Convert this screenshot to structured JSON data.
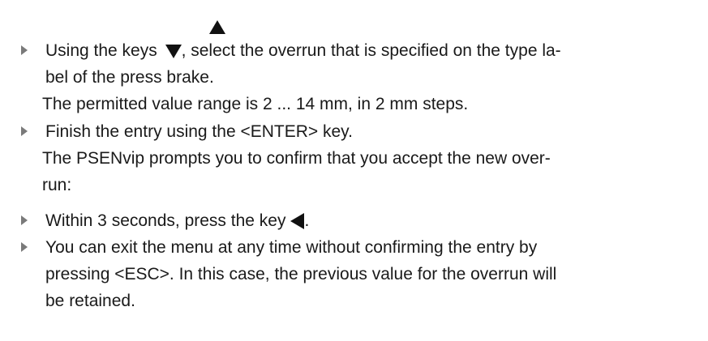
{
  "steps": [
    {
      "lines": [
        "Using the keys",
        ", select the overrun that is specified on the type la-",
        "bel of the press brake."
      ],
      "icons": [
        "up-arrow-key",
        "down-arrow-key"
      ],
      "result_lines": [
        "The permitted value range is 2 ... 14 mm, in 2 mm steps."
      ]
    },
    {
      "lines": [
        "Finish the entry using the <ENTER> key."
      ],
      "result_lines": [
        "The PSENvip prompts you to confirm that you accept the new over-",
        "run:"
      ]
    },
    {
      "lines": [
        "Within 3 seconds, press the key",
        "."
      ],
      "icons": [
        "left-arrow-key"
      ]
    },
    {
      "lines": [
        "You can exit the menu at any time without confirming the entry by",
        "pressing <ESC>. In this case, the previous value for the overrun will",
        "be retained."
      ]
    }
  ],
  "colors": {
    "text": "#1a1a1a",
    "bullet": "#7a7a7a",
    "key_glyph": "#111111"
  }
}
